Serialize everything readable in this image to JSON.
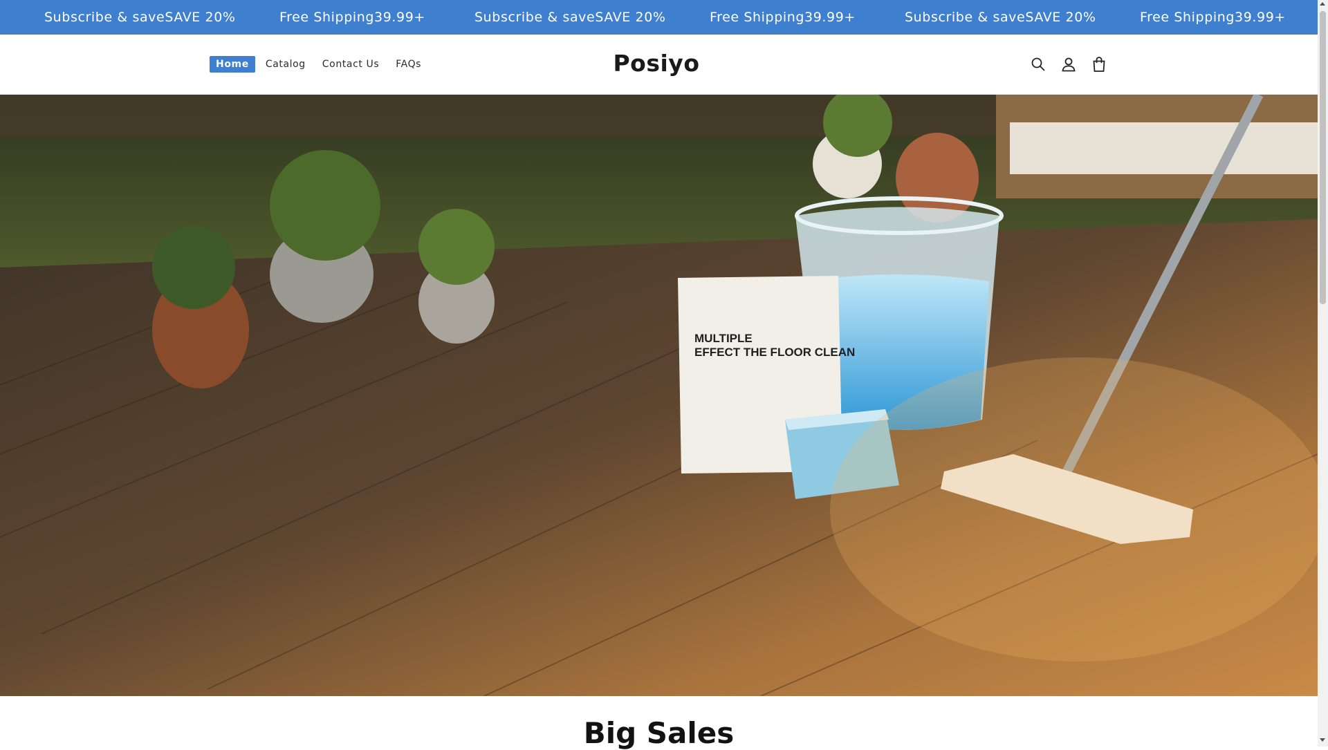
{
  "announcement": {
    "messages": [
      "Subscribe & saveSAVE 20%",
      "Free Shipping39.99+",
      "Subscribe & saveSAVE 20%",
      "Free Shipping39.99+",
      "Subscribe & saveSAVE 20%",
      "Free Shipping39.99+"
    ],
    "background": "#3f7fd0"
  },
  "header": {
    "nav": [
      {
        "label": "Home",
        "active": true
      },
      {
        "label": "Catalog",
        "active": false
      },
      {
        "label": "Contact Us",
        "active": false
      },
      {
        "label": "FAQs",
        "active": false
      }
    ],
    "logo": "Posiyo",
    "icons": [
      "search-icon",
      "account-icon",
      "cart-icon"
    ]
  },
  "hero": {
    "product_text_line1": "MULTIPLE",
    "product_text_line2": "EFFECT THE FLOOR CLEAN"
  },
  "section": {
    "title": "Big Sales"
  }
}
